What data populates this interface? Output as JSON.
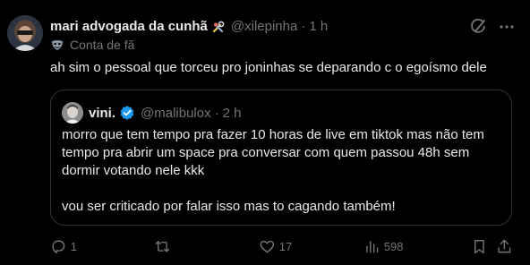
{
  "author": {
    "display_name": "mari advogada da cunhã",
    "handle": "@xilepinha",
    "time": "1 h",
    "dot": "·"
  },
  "community_label": "Conta de fã",
  "body": "ah sim o pessoal que torceu pro joninhas se deparando c o egoísmo dele",
  "quoted": {
    "display_name": "vini.",
    "handle": "@malibulox",
    "time": "2 h",
    "dot": "·",
    "paragraph_1": "morro que tem tempo pra fazer 10 horas de live em tiktok mas não tem tempo pra abrir um space pra conversar com quem passou 48h sem dormir votando nele kkk",
    "paragraph_2": "vou ser criticado por falar isso mas to cagando também!"
  },
  "actions": {
    "replies": "1",
    "retweets": "",
    "likes": "17",
    "views": "598"
  },
  "colors": {
    "background": "#000000",
    "text": "#e7e9ea",
    "muted": "#71767b",
    "border": "#2f3336",
    "verified": "#1d9bf0"
  },
  "icons": [
    "grok-icon",
    "more-icon",
    "mask-icon",
    "verified-icon",
    "reply-icon",
    "retweet-icon",
    "like-icon",
    "views-icon",
    "bookmark-icon",
    "share-icon"
  ]
}
